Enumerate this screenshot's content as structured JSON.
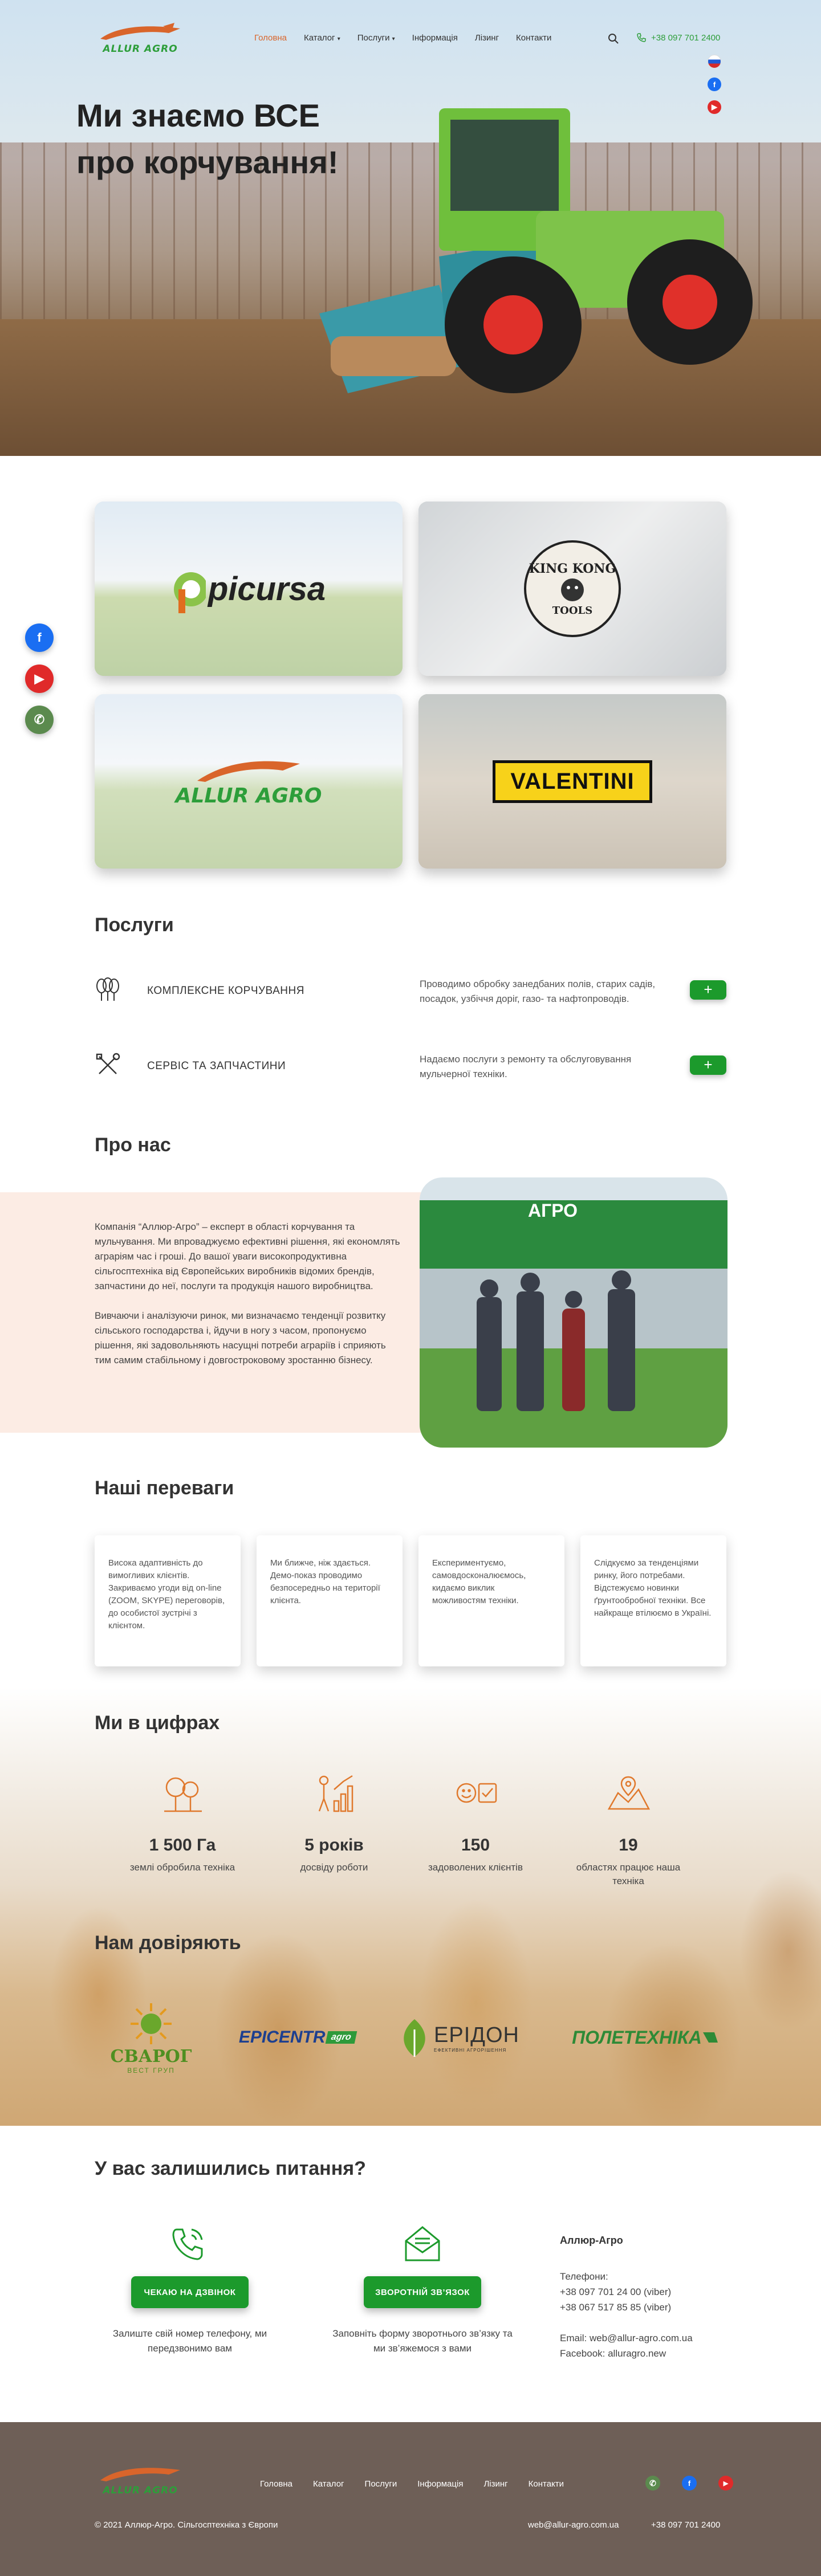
{
  "brand": {
    "logo_text": "ALLUR AGRO",
    "accent": "#d9652b",
    "green": "#1c9a2c",
    "footer_bg": "#6e5f57"
  },
  "nav": {
    "items": [
      {
        "label": "Головна"
      },
      {
        "label": "Каталог"
      },
      {
        "label": "Послуги"
      },
      {
        "label": "Інформація"
      },
      {
        "label": "Лізинг"
      },
      {
        "label": "Контакти"
      }
    ],
    "phone": "+38 097 701 2400"
  },
  "hero": {
    "title_line1": "Ми знаємо ВСЕ",
    "title_line2": "про корчування!"
  },
  "brands": [
    {
      "name": "picursa"
    },
    {
      "name": "KING KONG",
      "sub": "TOOLS"
    },
    {
      "name": "ALLUR AGRO"
    },
    {
      "name": "VALENTINI"
    }
  ],
  "services": {
    "title": "Послуги",
    "items": [
      {
        "name": "КОМПЛЕКСНЕ КОРЧУВАННЯ",
        "desc": "Проводимо обробку занедбаних полів, старих садів, посадок, узбіччя доріг, газо- та нафтопроводів.",
        "icon": "trees-icon"
      },
      {
        "name": "СЕРВІС ТА ЗАПЧАСТИНИ",
        "desc": "Надаємо послуги з ремонту та обслуговування мульчерної техніки.",
        "icon": "tools-icon"
      }
    ],
    "plus": "+"
  },
  "about": {
    "title": "Про нас",
    "p1": "Компанія “Аллюр-Агро” – експерт в області корчування та мульчування. Ми впроваджуємо ефективні рішення, які економлять аграріям час і гроші. До вашої уваги високопродуктивна сільгосптехніка від Європейських виробників відомих брендів, запчастини до неї, послуги та продукція нашого виробництва.",
    "p2": "Вивчаючи і аналізуючи ринок, ми визначаємо тенденції розвитку сільського господарства і, йдучи в ногу з часом, пропонуємо рішення, які задовольняють насущні потреби аграріїв і сприяють тим самим стабільному і довгостроковому зростанню бізнесу.",
    "photo_sign": "АГРО"
  },
  "advantages": {
    "title": "Наші переваги",
    "items": [
      "Висока адаптивність до вимогливих клієнтів. Закриваємо угоди від on-line (ZOOM, SKYPE) переговорів, до особистої зустрічі з клієнтом.",
      "Ми ближче, ніж здається. Демо-показ проводимо безпосередньо на території клієнта.",
      "Експериментуємо, самовдосконалюємось, кидаємо виклик можливостям техніки.",
      "Слідкуємо за тенденціями ринку, його потребами. Відстежуємо новинки ґрунтообробної техніки. Все найкраще втілюємо в Україні."
    ]
  },
  "stats": {
    "title": "Ми в цифрах",
    "items": [
      {
        "value": "1 500 Га",
        "label": "землі обробила техніка",
        "icon": "trees-icon"
      },
      {
        "value": "5 років",
        "label": "досвіду роботи",
        "icon": "growth-icon"
      },
      {
        "value": "150",
        "label": "задоволених клієнтів",
        "icon": "smile-check-icon"
      },
      {
        "value": "19",
        "label": "областях працює наша техніка",
        "icon": "map-icon"
      }
    ]
  },
  "partners": {
    "title": "Нам довіряють",
    "items": [
      {
        "name": "СВАРОГ",
        "sub": "ВЕСТ ГРУП"
      },
      {
        "name": "EPICENTR",
        "tag": "agro"
      },
      {
        "name": "ЕРІДОН",
        "sub": "ЕФЕКТИВНІ АГРОРІШЕННЯ"
      },
      {
        "name": "ПОЛЕТЕХНІКА"
      }
    ]
  },
  "contact": {
    "title": "У вас залишились питання?",
    "call_button": "ЧЕКАЮ НА ДЗВІНОК",
    "call_caption": "Залиште свій номер телефону, ми передзвонимо вам",
    "form_button": "ЗВОРОТНІЙ ЗВ’ЯЗОК",
    "form_caption": "Заповніть форму зворотнього зв’язку та ми зв’яжемося з вами",
    "company": "Аллюр-Агро",
    "phones_label": "Телефони:",
    "phone1": "+38 097 701 24 00 (viber)",
    "phone2": "+38 067 517 85 85 (viber)",
    "email_line": "Email:  web@allur-agro.com.ua",
    "facebook_line": "Facebook: alluragro.new"
  },
  "footer": {
    "items": [
      "Головна",
      "Каталог",
      "Послуги",
      "Інформація",
      "Лізинг",
      "Контакти"
    ],
    "copyright": "© 2021 Аллюр-Агро. Сільгосптехніка з Європи",
    "email": "web@allur-agro.com.ua",
    "phone": "+38 097 701 2400"
  }
}
